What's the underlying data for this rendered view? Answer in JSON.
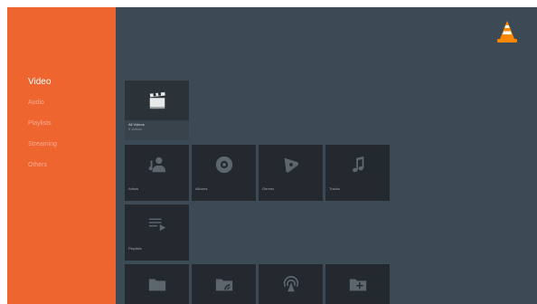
{
  "sidebar": {
    "items": [
      {
        "label": "Video",
        "active": true
      },
      {
        "label": "Audio",
        "active": false
      },
      {
        "label": "Playlists",
        "active": false
      },
      {
        "label": "Streaming",
        "active": false
      },
      {
        "label": "Others",
        "active": false
      }
    ]
  },
  "logo": {
    "icon": "vlc-cone-icon"
  },
  "tiles": {
    "all_videos": {
      "title": "All Videos",
      "subtitle": "0 videos",
      "icon": "film-clapper-icon"
    },
    "artists": {
      "label": "Artists",
      "icon": "artist-icon"
    },
    "albums": {
      "label": "Albums",
      "icon": "disc-icon"
    },
    "genres": {
      "label": "Genres",
      "icon": "guitar-pick-icon"
    },
    "tracks": {
      "label": "Tracks",
      "icon": "music-note-icon"
    },
    "playlists": {
      "label": "Playlists",
      "icon": "playlist-icon"
    },
    "folder": {
      "icon": "folder-icon"
    },
    "network_folder": {
      "icon": "network-folder-icon"
    },
    "stream": {
      "icon": "stream-icon"
    },
    "add_folder": {
      "icon": "add-folder-icon"
    }
  },
  "colors": {
    "sidebar": "#ee6530",
    "background": "#3c4a55",
    "tile": "#23292e",
    "accent": "#ff8800"
  }
}
